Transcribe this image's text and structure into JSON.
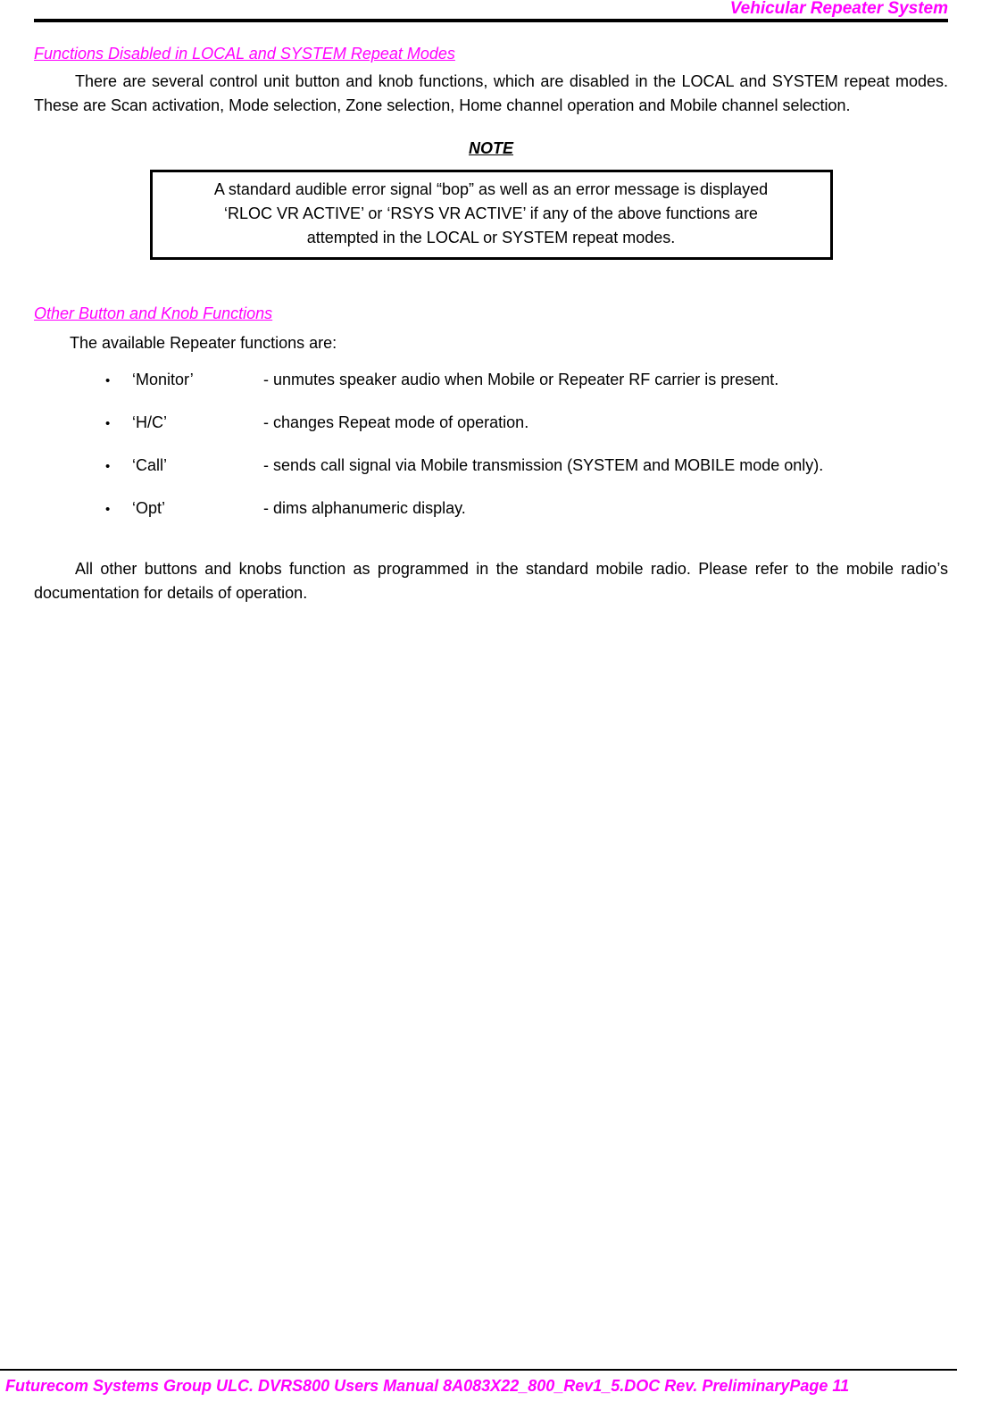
{
  "header": {
    "title": "Vehicular Repeater System"
  },
  "sections": [
    {
      "heading": "Functions Disabled in LOCAL and SYSTEM Repeat Modes",
      "paragraph": "There are several control unit button and knob functions, which are disabled in the LOCAL and SYSTEM repeat modes.  These are Scan activation, Mode selection, Zone selection, Home channel operation and Mobile channel selection."
    },
    {
      "heading": "Other Button and Knob Functions",
      "intro": "The available Repeater functions are:",
      "closing": "All other buttons and knobs function as programmed in the standard mobile radio. Please refer to the mobile radio’s documentation for details of operation."
    }
  ],
  "note": {
    "title": "NOTE",
    "lines": [
      "A standard audible error signal “bop” as well as an error message is displayed",
      "‘RLOC VR ACTIVE’ or ‘RSYS VR ACTIVE’ if any of the above functions are",
      "attempted in the LOCAL or SYSTEM repeat modes."
    ]
  },
  "functions_list": [
    {
      "bullet": "•",
      "term": "‘Monitor’",
      "description": "- unmutes speaker audio when Mobile or Repeater RF carrier is present."
    },
    {
      "bullet": "•",
      "term": "‘H/C’",
      "description": "- changes Repeat mode of operation."
    },
    {
      "bullet": "•",
      "term": "‘Call’",
      "description": "- sends call signal via Mobile transmission (SYSTEM and MOBILE mode only)."
    },
    {
      "bullet": "•",
      "term": "‘Opt’",
      "description": "- dims alphanumeric display."
    }
  ],
  "footer": {
    "text": "Futurecom Systems Group ULC. DVRS800 Users Manual 8A083X22_800_Rev1_5.DOC Rev. PreliminaryPage 11"
  },
  "colors": {
    "accent": "#ff00ff",
    "text": "#000000",
    "background": "#ffffff"
  }
}
